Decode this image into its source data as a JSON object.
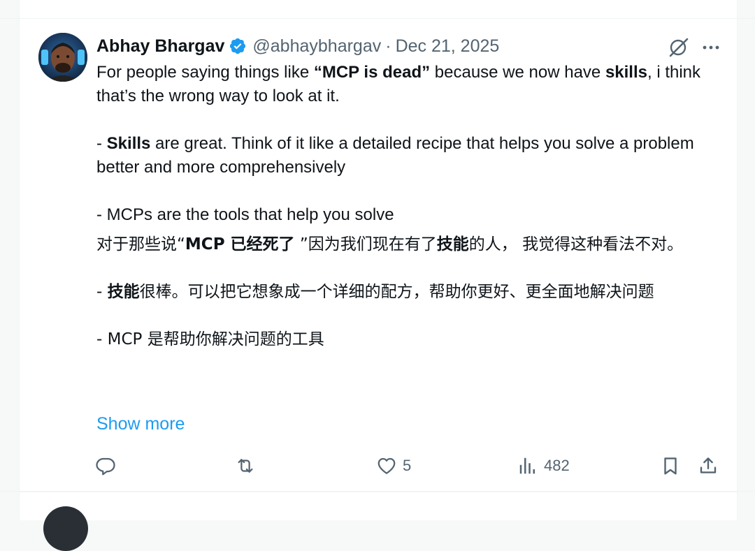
{
  "tweet": {
    "author": {
      "name": "Abhay Bhargav",
      "handle": "@abhaybhargav",
      "separator": "·",
      "date": "Dec 21, 2025",
      "verified": true
    },
    "body": {
      "en_line1_pre": "For people saying things like ",
      "en_line1_bold1": "“MCP is dead”",
      "en_line1_mid": " because we now have ",
      "en_line1_bold2": "skills",
      "en_line1_post": ", i think that’s the wrong way to look at it.",
      "en_point1_dash": "- ",
      "en_point1_bold": "Skills",
      "en_point1_rest": " are great. Think of it like a detailed recipe that helps you solve a problem better and more comprehensively",
      "en_point2": "- MCPs are the tools that help you solve",
      "zh_line1_pre": "对于那些说“",
      "zh_line1_bold1": "MCP 已经死了",
      "zh_line1_mid": " ”因为我们现在有了",
      "zh_line1_bold2": "技能",
      "zh_line1_post": "的人， 我觉得这种看法不对。",
      "zh_point1_dash": "- ",
      "zh_point1_bold": "技能",
      "zh_point1_rest": "很棒。可以把它想象成一个详细的配方，帮助你更好、更全面地解决问题",
      "zh_point2": "- MCP 是帮助你解决问题的工具"
    },
    "show_more": "Show more",
    "actions": {
      "reply_count": "",
      "retweet_count": "",
      "like_count": "5",
      "views_count": "482"
    },
    "icons": {
      "top": [
        "grok-icon",
        "more-icon"
      ],
      "actions": [
        "reply-icon",
        "retweet-icon",
        "like-icon",
        "views-icon",
        "bookmark-icon",
        "share-icon"
      ]
    },
    "colors": {
      "link": "#1d9bf0",
      "verified": "#1d9bf0",
      "muted": "#536471",
      "text": "#0f1419"
    }
  }
}
